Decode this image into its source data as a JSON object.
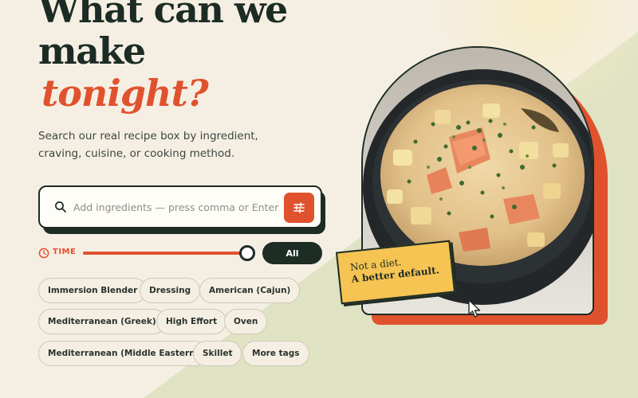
{
  "hero": {
    "title_line1": "What can we",
    "title_line2": "make",
    "title_accent": "tonight?",
    "subtitle": "Search our real recipe box by ingredient, craving, cuisine, or cooking method."
  },
  "search": {
    "placeholder": "Add ingredients — press comma or Enter",
    "value": ""
  },
  "time_filter": {
    "label": "TIME",
    "level_percent": 100,
    "button_label": "All"
  },
  "tags": [
    "Immersion Blender",
    "Dressing",
    "American (Cajun)",
    "Mediterranean (Greek)",
    "High Effort",
    "Oven",
    "Mediterranean (Middle Eastern)",
    "Skillet",
    "More tags"
  ],
  "sticker": {
    "line1": "Not a diet.",
    "line2": "A better default."
  },
  "icons": {
    "search": "search-icon",
    "filter": "sliders-icon",
    "time": "clock-icon",
    "cursor": "mouse-pointer-icon"
  },
  "colors": {
    "accent": "#e0522e",
    "dark": "#1d2c24",
    "background": "#f5efe3",
    "sticker": "#f6c453",
    "green_wash": "#dfe3c3"
  }
}
